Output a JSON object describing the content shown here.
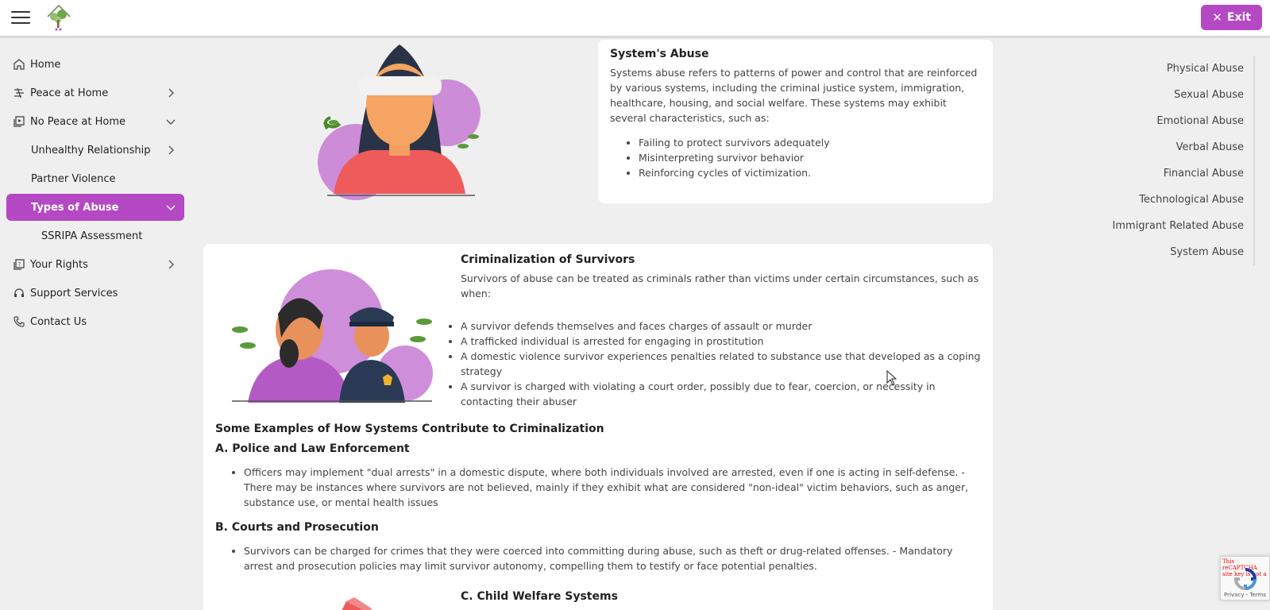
{
  "header": {
    "exit_label": "Exit",
    "accent": "#b449c3"
  },
  "sidebar": {
    "items": [
      {
        "label": "Home"
      },
      {
        "label": "Peace at Home"
      },
      {
        "label": "No Peace at Home"
      },
      {
        "label": "Unhealthy Relationship"
      },
      {
        "label": "Partner Violence"
      },
      {
        "label": "Types of Abuse"
      },
      {
        "label": "SSRIPA Assessment"
      },
      {
        "label": "Your Rights"
      },
      {
        "label": "Support Services"
      },
      {
        "label": "Contact Us"
      }
    ]
  },
  "toc": {
    "items": [
      "Physical Abuse",
      "Sexual Abuse",
      "Emotional Abuse",
      "Verbal Abuse",
      "Financial Abuse",
      "Technological Abuse",
      "Immigrant Related Abuse",
      "System Abuse"
    ]
  },
  "systems_abuse": {
    "title": "System's Abuse",
    "intro": "Systems abuse refers to patterns of power and control that are reinforced by various systems, including the criminal justice system, immigration, healthcare, housing, and social welfare. These systems may exhibit several characteristics, such as:",
    "bullets": [
      "Failing to protect survivors adequately",
      "Misinterpreting survivor behavior",
      "Reinforcing cycles of victimization."
    ]
  },
  "criminalization": {
    "title": "Criminalization of Survivors",
    "intro": "Survivors of abuse can be treated as criminals rather than victims under certain circumstances, such as when:",
    "bullets": [
      "A survivor defends themselves and faces charges of assault or murder",
      "A trafficked individual is arrested for engaging in prostitution",
      "A domestic violence survivor experiences penalties related to substance use that developed as a coping strategy",
      "A survivor is charged with violating a court order, possibly due to fear, coercion, or necessity in contacting their abuser"
    ],
    "examples_title": "Some Examples of How Systems Contribute to Criminalization",
    "police_title": "A. Police and Law Enforcement",
    "police_bullet": "Officers may implement \"dual arrests\" in a domestic dispute, where both individuals involved are arrested, even if one is acting in self-defense. - There may be instances where survivors are not believed, mainly if they exhibit what are considered \"non-ideal\" victim behaviors, such as anger, substance use, or mental health issues",
    "courts_title": "B. Courts and Prosecution",
    "courts_bullet": "Survivors can be charged for crimes that they were coerced into committing during abuse, such as theft or drug-related offenses. - Mandatory arrest and prosecution policies may limit survivor autonomy, compelling them to testify or face potential penalties.",
    "child_welfare_title": "C. Child Welfare Systems"
  },
  "recaptcha": {
    "error": "This reCAPTCHA site key is not a",
    "terms": "Privacy - Terms"
  }
}
